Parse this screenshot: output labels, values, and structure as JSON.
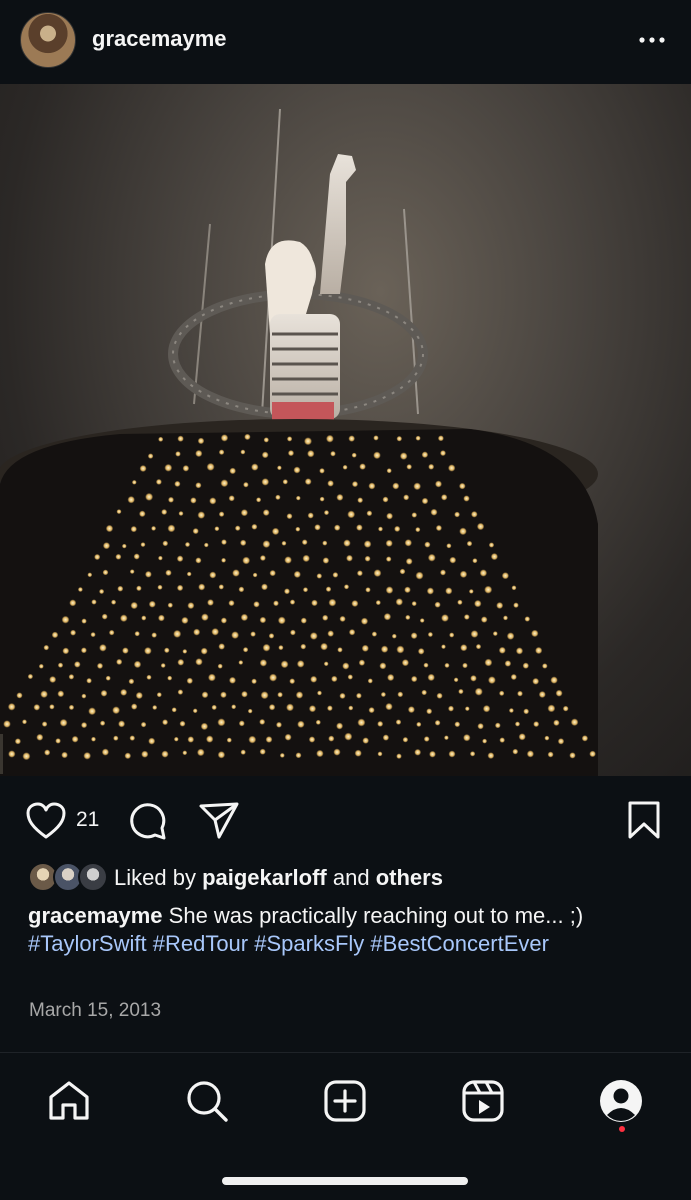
{
  "post": {
    "username": "gracemayme",
    "more_icon": "more-horizontal-icon",
    "photo_description_icon": "concert-photo"
  },
  "actions": {
    "like_icon": "heart-icon",
    "like_count": "21",
    "comment_icon": "comment-icon",
    "share_icon": "send-icon",
    "save_icon": "bookmark-icon"
  },
  "likes": {
    "prefix": "Liked by ",
    "user": "paigekarloff",
    "middle": " and ",
    "others": "others"
  },
  "caption": {
    "username": "gracemayme",
    "text": " She was practically reaching out to me... ;) ",
    "hashtags": [
      "#TaylorSwift",
      "#RedTour",
      "#SparksFly",
      "#BestConcertEver"
    ]
  },
  "date": "March 15, 2013",
  "nav": {
    "items": [
      "home-icon",
      "search-icon",
      "create-icon",
      "reels-icon",
      "profile-icon"
    ]
  },
  "colors": {
    "background": "#0c1014",
    "hashtag": "#a8c7fa",
    "notification": "#ff3040"
  }
}
